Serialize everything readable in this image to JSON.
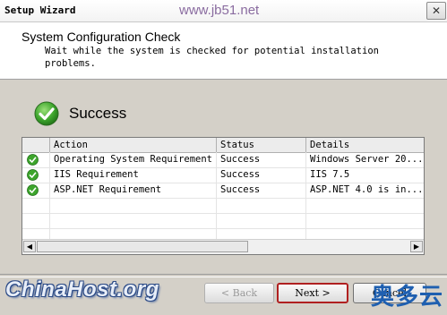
{
  "window": {
    "title": "Setup Wizard",
    "close_glyph": "✕",
    "watermark": "www.jb51.net"
  },
  "header": {
    "title": "System Configuration Check",
    "subtitle": "Wait while the system is checked for potential installation problems."
  },
  "status": {
    "icon": "success-check-icon",
    "text": "Success",
    "color": "#3a9a2a"
  },
  "table": {
    "columns": [
      "Action",
      "Status",
      "Details"
    ],
    "rows": [
      {
        "icon": "check-icon",
        "action": "Operating System Requirement",
        "status": "Success",
        "details": "Windows Server 20..."
      },
      {
        "icon": "check-icon",
        "action": "IIS Requirement",
        "status": "Success",
        "details": "IIS 7.5"
      },
      {
        "icon": "check-icon",
        "action": "ASP.NET Requirement",
        "status": "Success",
        "details": "ASP.NET 4.0 is in..."
      }
    ]
  },
  "scrollbar": {
    "left_arrow": "◀",
    "right_arrow": "▶"
  },
  "footer": {
    "logo_text": "ChinaHost.org",
    "cjk_watermark": "奥多云",
    "back_label": "< Back",
    "next_label": "Next >",
    "cancel_label": "Cancel"
  }
}
